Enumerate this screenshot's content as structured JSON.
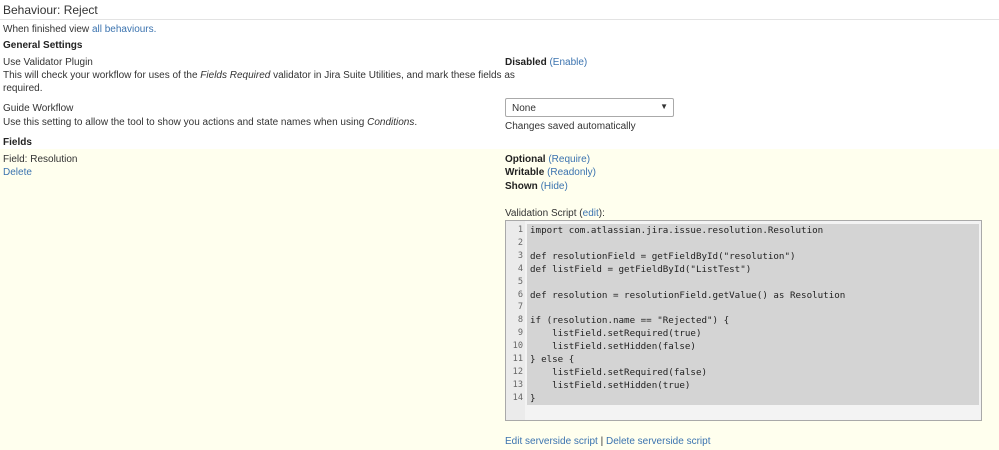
{
  "header": {
    "title": "Behaviour: Reject"
  },
  "intro": {
    "text": "When finished view ",
    "link": "all behaviours."
  },
  "general": {
    "heading": "General Settings",
    "validator": {
      "label": "Use Validator Plugin",
      "desc_pre": "This will check your workflow for uses of the ",
      "desc_em": "Fields Required",
      "desc_post": " validator in Jira Suite Utilities, and mark these fields as",
      "desc_line2": "required.",
      "status": "Disabled",
      "action": "(Enable)"
    },
    "guide": {
      "label": "Guide Workflow",
      "desc_pre": "Use this setting to allow the tool to show you actions and state names when using ",
      "desc_em": "Conditions",
      "desc_post": ".",
      "select_value": "None",
      "saved_note": "Changes saved automatically"
    }
  },
  "fields": {
    "heading": "Fields",
    "field_name": "Field: Resolution",
    "delete_label": "Delete",
    "optional": "Optional",
    "optional_action": "(Require)",
    "writable": "Writable",
    "writable_action": "(Readonly)",
    "shown": "Shown",
    "shown_action": "(Hide)",
    "script_label": "Validation Script (",
    "script_edit": "edit",
    "script_label_end": "):",
    "code_lines": [
      "import com.atlassian.jira.issue.resolution.Resolution",
      "",
      "def resolutionField = getFieldById(\"resolution\")",
      "def listField = getFieldById(\"ListTest\")",
      "",
      "def resolution = resolutionField.getValue() as Resolution",
      "",
      "if (resolution.name == \"Rejected\") {",
      "    listField.setRequired(true)",
      "    listField.setHidden(false)",
      "} else {",
      "    listField.setRequired(false)",
      "    listField.setHidden(true)",
      "}"
    ],
    "edit_server": "Edit serverside script",
    "separator": "|",
    "delete_server": "Delete serverside script"
  }
}
